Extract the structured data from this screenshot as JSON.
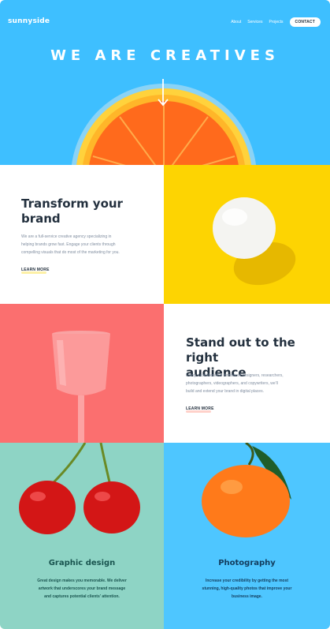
{
  "header": {
    "logo": "sunnyside",
    "nav": {
      "about": "About",
      "services": "Services",
      "projects": "Projects",
      "contact": "CONTACT"
    }
  },
  "hero": {
    "title": "WE ARE CREATIVES"
  },
  "features": {
    "transform": {
      "title_line1": "Transform your",
      "title_line2": "brand",
      "body_lines": [
        "We are a full-service creative agency specializing in",
        "helping brands grow fast. Engage your clients through",
        "compelling visuals that do most of the marketing for you."
      ],
      "link": "LEARN MORE"
    },
    "standout": {
      "title_line1": "Stand out to the right",
      "title_line2": "audience",
      "body_lines": [
        "Using a collaborative formula of designers, researchers,",
        "photographers, videographers, and copywriters, we'll",
        "build and extend your brand in digital places."
      ],
      "link": "LEARN MORE"
    }
  },
  "services": {
    "graphic": {
      "title": "Graphic design",
      "body_lines": [
        "Great design makes you memorable. We deliver",
        "artwork that underscores your brand message",
        "and captures potential clients' attention."
      ]
    },
    "photo": {
      "title": "Photography",
      "body_lines": [
        "Increase your credibility by getting the most",
        "stunning, high-quality photos that improve your",
        "business image."
      ]
    }
  },
  "colors": {
    "hero_bg": "#3ebfff",
    "egg_bg": "#fdd402",
    "glass_bg": "#fb6f6f",
    "graphic_bg": "#8ed4c5",
    "photo_bg": "#4ec6ff",
    "dark_text": "#23303e",
    "yellow_accent": "#fad400",
    "pink_accent": "#fe7a66"
  }
}
